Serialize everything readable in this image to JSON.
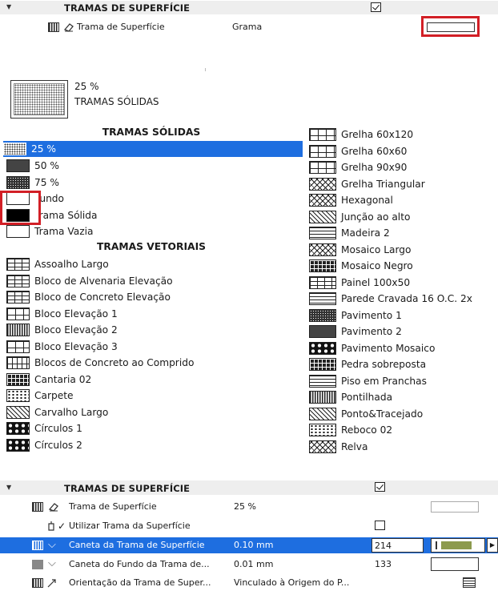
{
  "top_section": {
    "title": "TRAMAS DE SUPERFÍCIE",
    "checked": true,
    "row": {
      "label": "Trama de Superfície",
      "value": "Grama"
    }
  },
  "preview": {
    "percent": "25 %",
    "name": "TRAMAS SÓLIDAS"
  },
  "left_list": {
    "solid_header": "TRAMAS SÓLIDAS",
    "solid_items": [
      "25 %",
      "50 %",
      "75 %",
      "Fundo",
      "Trama Sólida",
      "Trama Vazia"
    ],
    "vector_header": "TRAMAS VETORIAIS",
    "vector_items": [
      "Assoalho Largo",
      "Bloco de Alvenaria Elevação",
      "Bloco de Concreto Elevação",
      "Bloco Elevação 1",
      "Bloco Elevação 2",
      "Bloco Elevação 3",
      "Blocos de Concreto ao Comprido",
      "Cantaria 02",
      "Carpete",
      "Carvalho Largo",
      "Círculos 1",
      "Círculos 2"
    ]
  },
  "right_list": {
    "items": [
      "Grelha 60x120",
      "Grelha 60x60",
      "Grelha 90x90",
      "Grelha Triangular",
      "Hexagonal",
      "Junção ao alto",
      "Madeira 2",
      "Mosaico Largo",
      "Mosaico Negro",
      "Painel 100x50",
      "Parede Cravada 16 O.C. 2x",
      "Pavimento 1",
      "Pavimento 2",
      "Pavimento Mosaico",
      "Pedra sobreposta",
      "Piso em Pranchas",
      "Pontilhada",
      "Ponto&Tracejado",
      "Reboco 02",
      "Relva"
    ]
  },
  "bottom_section": {
    "title": "TRAMAS DE SUPERFÍCIE",
    "checked": true,
    "rows": [
      {
        "label": "Trama de Superfície",
        "value": "25 %"
      },
      {
        "label": "Utilizar Trama da Superfície",
        "value": ""
      },
      {
        "label": "Caneta da Trama de Superfície",
        "value": "0.10 mm",
        "pen": "214"
      },
      {
        "label": "Caneta do Fundo da Trama de...",
        "value": "0.01 mm",
        "pen": "133"
      },
      {
        "label": "Orientação da Trama de Super...",
        "value": "Vinculado à Origem do P..."
      }
    ]
  },
  "colors": {
    "selection": "#1e6ee0",
    "highlight_box": "#d21f26",
    "pen_swatch": "#8c9a4e"
  }
}
